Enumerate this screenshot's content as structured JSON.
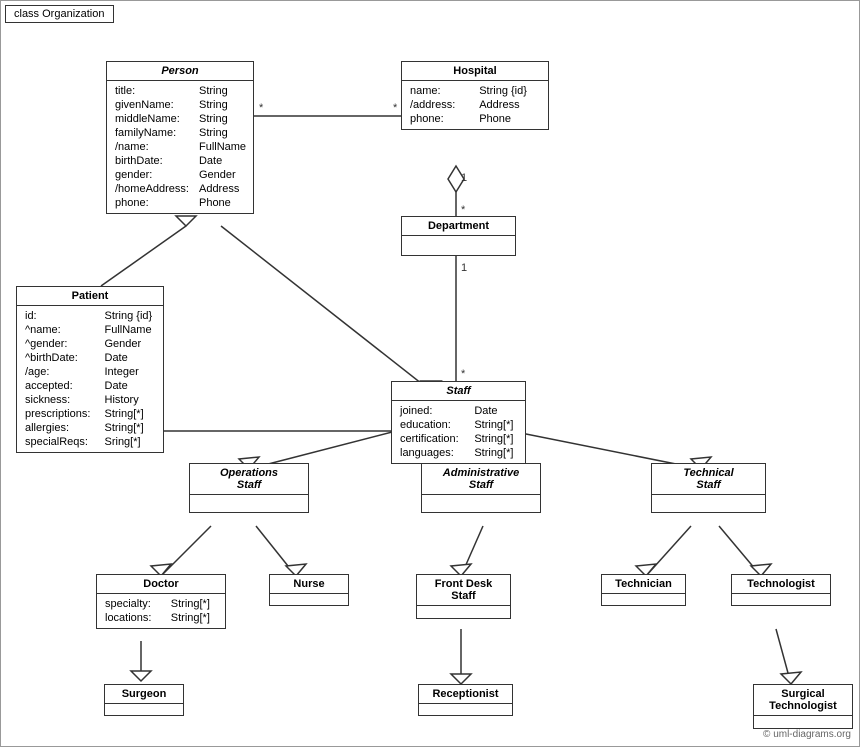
{
  "title": "class Organization",
  "copyright": "© uml-diagrams.org",
  "classes": {
    "person": {
      "name": "Person",
      "italic": true,
      "attributes": [
        {
          "name": "title:",
          "type": "String"
        },
        {
          "name": "givenName:",
          "type": "String"
        },
        {
          "name": "middleName:",
          "type": "String"
        },
        {
          "name": "familyName:",
          "type": "String"
        },
        {
          "name": "/name:",
          "type": "FullName"
        },
        {
          "name": "birthDate:",
          "type": "Date"
        },
        {
          "name": "gender:",
          "type": "Gender"
        },
        {
          "name": "/homeAddress:",
          "type": "Address"
        },
        {
          "name": "phone:",
          "type": "Phone"
        }
      ]
    },
    "hospital": {
      "name": "Hospital",
      "italic": false,
      "attributes": [
        {
          "name": "name:",
          "type": "String {id}"
        },
        {
          "name": "/address:",
          "type": "Address"
        },
        {
          "name": "phone:",
          "type": "Phone"
        }
      ]
    },
    "patient": {
      "name": "Patient",
      "italic": false,
      "attributes": [
        {
          "name": "id:",
          "type": "String {id}"
        },
        {
          "name": "^name:",
          "type": "FullName"
        },
        {
          "name": "^gender:",
          "type": "Gender"
        },
        {
          "name": "^birthDate:",
          "type": "Date"
        },
        {
          "name": "/age:",
          "type": "Integer"
        },
        {
          "name": "accepted:",
          "type": "Date"
        },
        {
          "name": "sickness:",
          "type": "History"
        },
        {
          "name": "prescriptions:",
          "type": "String[*]"
        },
        {
          "name": "allergies:",
          "type": "String[*]"
        },
        {
          "name": "specialReqs:",
          "type": "Sring[*]"
        }
      ]
    },
    "department": {
      "name": "Department",
      "italic": false,
      "attributes": []
    },
    "staff": {
      "name": "Staff",
      "italic": true,
      "attributes": [
        {
          "name": "joined:",
          "type": "Date"
        },
        {
          "name": "education:",
          "type": "String[*]"
        },
        {
          "name": "certification:",
          "type": "String[*]"
        },
        {
          "name": "languages:",
          "type": "String[*]"
        }
      ]
    },
    "operations_staff": {
      "name": "Operations Staff",
      "italic": true
    },
    "administrative_staff": {
      "name": "Administrative Staff",
      "italic": true
    },
    "technical_staff": {
      "name": "Technical Staff",
      "italic": true
    },
    "doctor": {
      "name": "Doctor",
      "italic": false,
      "attributes": [
        {
          "name": "specialty:",
          "type": "String[*]"
        },
        {
          "name": "locations:",
          "type": "String[*]"
        }
      ]
    },
    "nurse": {
      "name": "Nurse",
      "italic": false
    },
    "front_desk_staff": {
      "name": "Front Desk Staff",
      "italic": false
    },
    "technician": {
      "name": "Technician",
      "italic": false
    },
    "technologist": {
      "name": "Technologist",
      "italic": false
    },
    "surgeon": {
      "name": "Surgeon",
      "italic": false
    },
    "receptionist": {
      "name": "Receptionist",
      "italic": false
    },
    "surgical_technologist": {
      "name": "Surgical Technologist",
      "italic": false
    }
  }
}
